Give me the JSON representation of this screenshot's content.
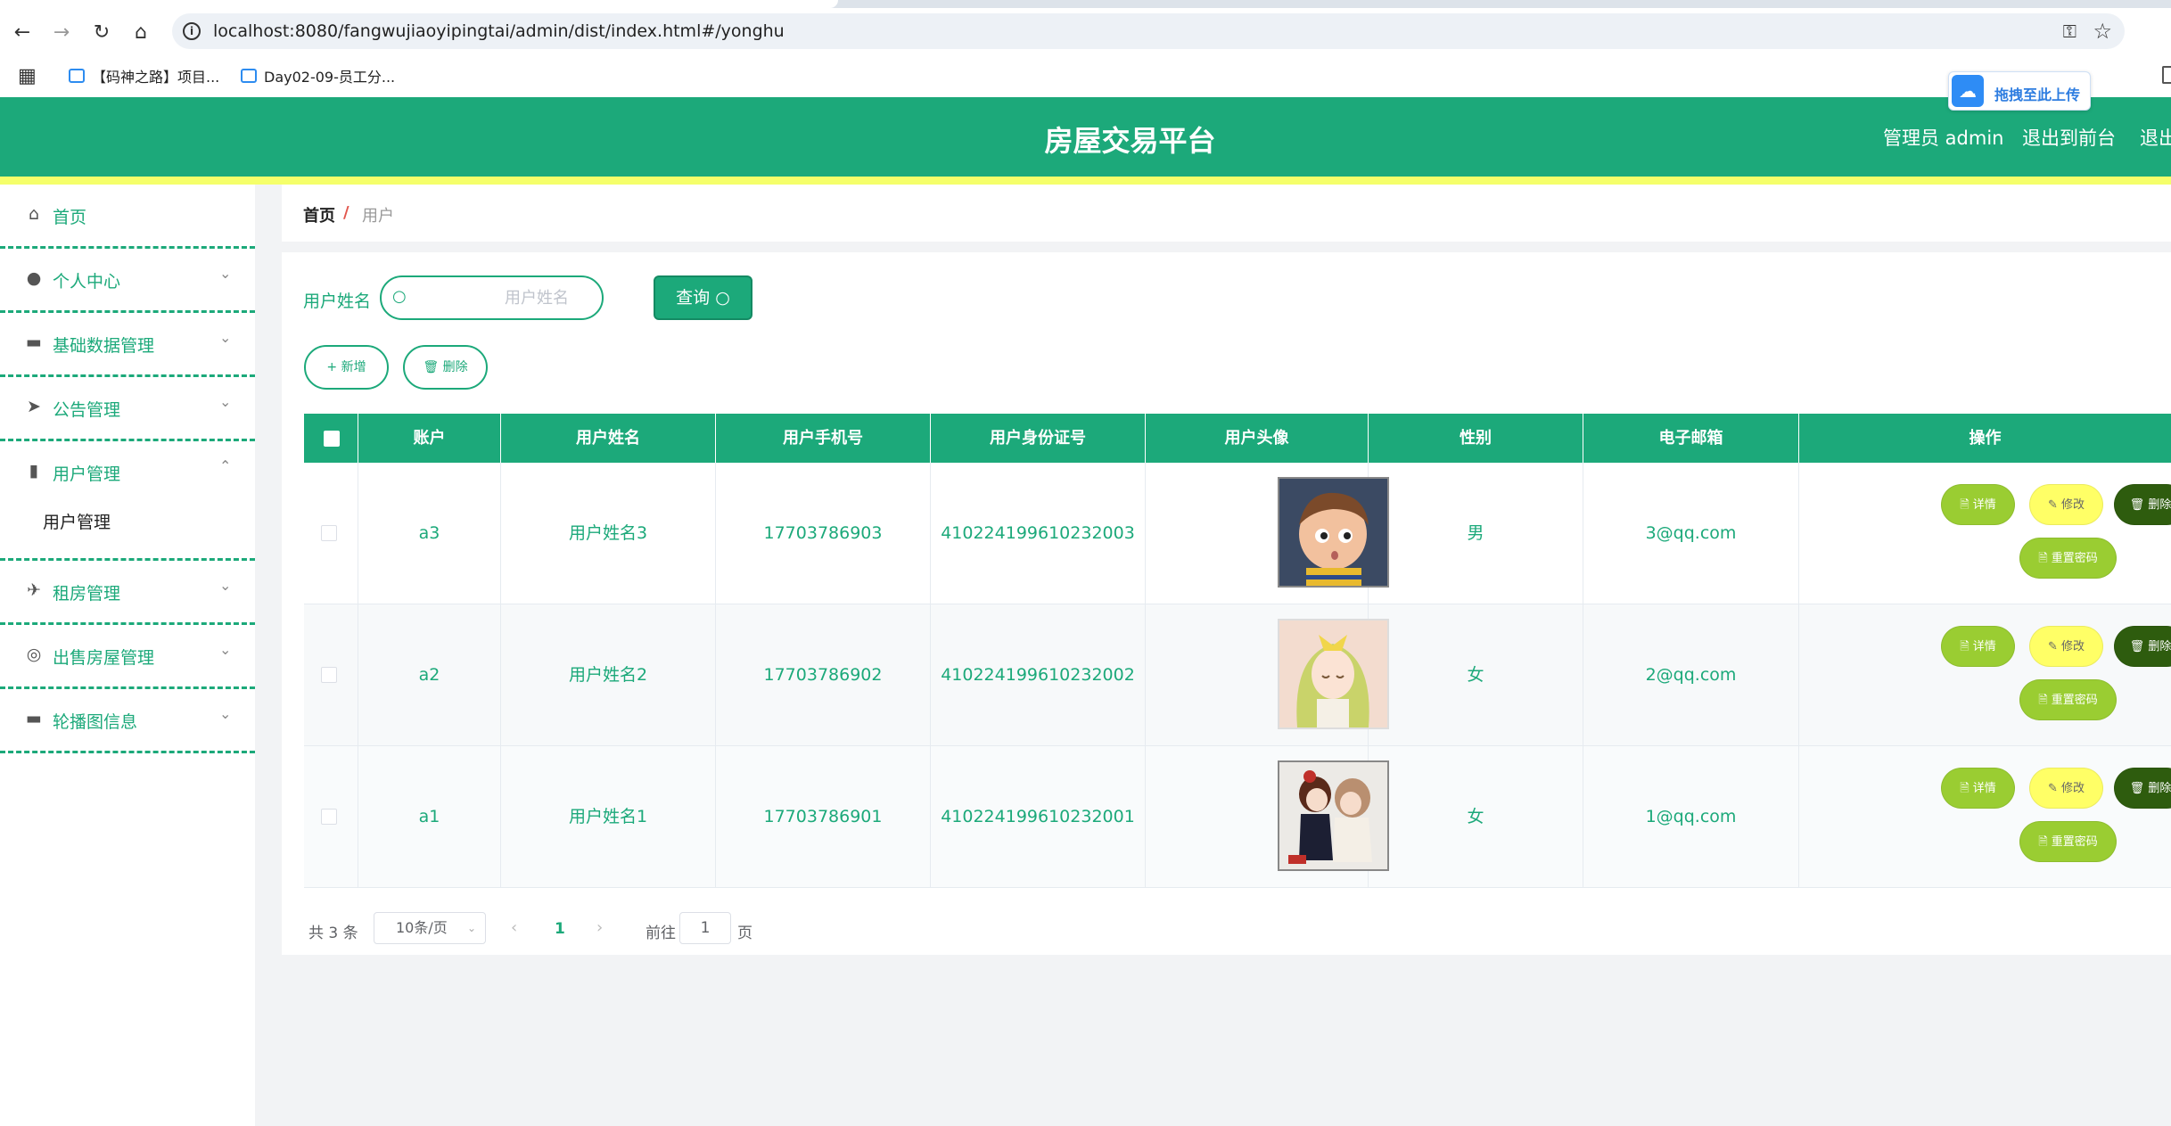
{
  "browser": {
    "url": "localhost:8080/fangwujiaoyipingtai/admin/dist/index.html#/yonghu",
    "bookmarks": [
      "【码神之路】项目...",
      "Day02-09-员工分..."
    ]
  },
  "header": {
    "title": "房屋交易平台",
    "admin_label": "管理员 admin",
    "front_link": "退出到前台",
    "logout_link": "退出登录",
    "upload_widget": "拖拽至此上传",
    "colors": {
      "primary": "#1ca97a",
      "accent_bar": "#f5ff6a"
    }
  },
  "sidebar": {
    "items": [
      {
        "label": "首页",
        "icon": "home-icon"
      },
      {
        "label": "个人中心",
        "icon": "user-icon"
      },
      {
        "label": "基础数据管理",
        "icon": "briefcase-icon"
      },
      {
        "label": "公告管理",
        "icon": "send-icon"
      },
      {
        "label": "用户管理",
        "icon": "bar-chart-icon"
      },
      {
        "label": "租房管理",
        "icon": "paper-plane-icon"
      },
      {
        "label": "出售房屋管理",
        "icon": "compass-icon"
      },
      {
        "label": "轮播图信息",
        "icon": "monitor-icon"
      }
    ],
    "submenu_active": "用户管理"
  },
  "breadcrumb": {
    "home": "首页",
    "separator": "/",
    "current": "用户"
  },
  "search": {
    "label": "用户姓名",
    "placeholder": "用户姓名",
    "button": "查询"
  },
  "actions": {
    "add": "新增",
    "delete": "删除"
  },
  "table": {
    "headers": [
      "账户",
      "用户姓名",
      "用户手机号",
      "用户身份证号",
      "用户头像",
      "性别",
      "电子邮箱",
      "操作"
    ],
    "rows": [
      {
        "account": "a3",
        "name": "用户姓名3",
        "phone": "17703786903",
        "id_card": "410224199610232003",
        "gender": "男",
        "email": "3@qq.com"
      },
      {
        "account": "a2",
        "name": "用户姓名2",
        "phone": "17703786902",
        "id_card": "410224199610232002",
        "gender": "女",
        "email": "2@qq.com"
      },
      {
        "account": "a1",
        "name": "用户姓名1",
        "phone": "17703786901",
        "id_card": "410224199610232001",
        "gender": "女",
        "email": "1@qq.com"
      }
    ],
    "row_actions": {
      "detail": "详情",
      "edit": "修改",
      "delete": "删除",
      "reset": "重置密码"
    }
  },
  "pagination": {
    "total": "共 3 条",
    "page_size": "10条/页",
    "current_page": "1",
    "goto_label": "前往",
    "goto_value": "1",
    "goto_unit": "页"
  }
}
